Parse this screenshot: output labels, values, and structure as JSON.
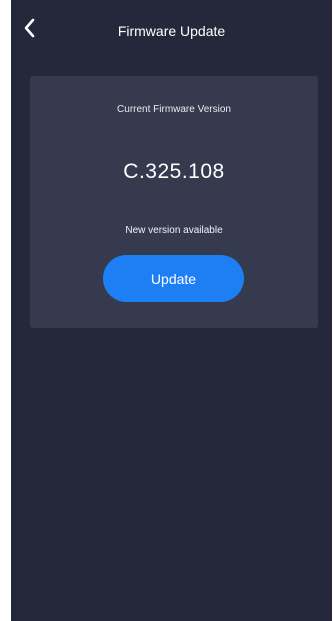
{
  "header": {
    "back_icon": "chevron-left-icon",
    "title": "Firmware Update"
  },
  "firmware": {
    "label": "Current Firmware Version",
    "version": "C.325.108",
    "status": "New version available",
    "update_label": "Update"
  },
  "colors": {
    "background": "#25283a",
    "card": "#363a4f",
    "accent": "#1e7ff5",
    "text": "#ffffff"
  }
}
